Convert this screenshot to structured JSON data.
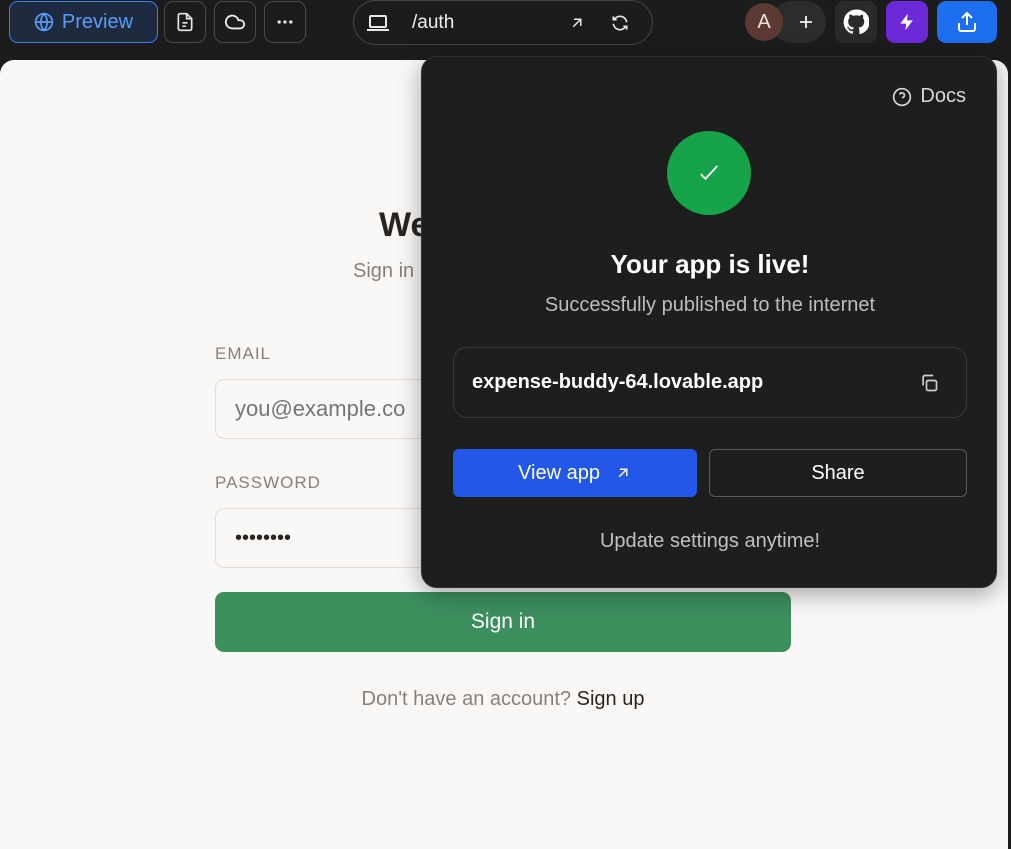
{
  "toolbar": {
    "preview_label": "Preview",
    "url_path": "/auth",
    "avatar_initial": "A"
  },
  "colors": {
    "accent_blue": "#1d6ef0",
    "success_green": "#16a34a",
    "signin_green": "#3d8f5e",
    "bolt_purple": "#6d28d9"
  },
  "icons": {
    "preview": "globe-icon",
    "file": "file-icon",
    "cloud": "cloud-icon",
    "more": "more-icon",
    "device": "laptop-icon",
    "open_external": "arrow-up-right-icon",
    "refresh": "refresh-icon",
    "add": "plus-icon",
    "github": "github-icon",
    "bolt": "bolt-icon",
    "publish": "upload-icon",
    "docs": "help-circle-icon",
    "success": "check-icon",
    "copy": "copy-icon"
  },
  "auth_page": {
    "title": "We",
    "subtitle": "Sign in",
    "email_label": "EMAIL",
    "email_placeholder": "you@example.co",
    "password_label": "PASSWORD",
    "password_value": "••••••••",
    "signin_label": "Sign in",
    "no_account_text": "Don't have an account?",
    "signup_link": "Sign up"
  },
  "publish_popover": {
    "docs_label": "Docs",
    "title": "Your app is live!",
    "subtitle": "Successfully published to the internet",
    "app_url": "expense-buddy-64.lovable.app",
    "view_app_label": "View app",
    "share_label": "Share",
    "footer_note": "Update settings anytime!"
  }
}
